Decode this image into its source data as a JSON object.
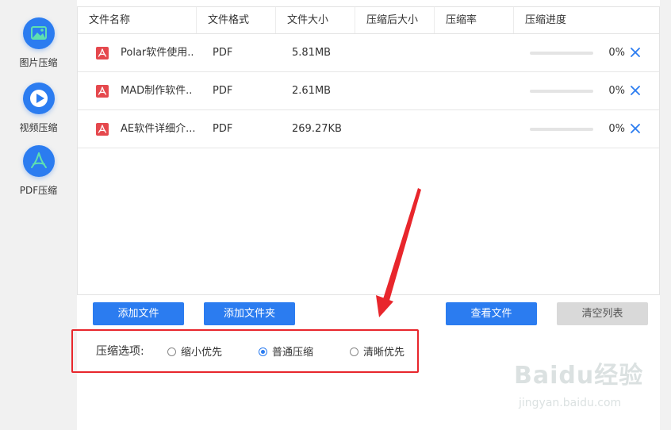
{
  "sidebar": {
    "items": [
      {
        "label": "图片压缩",
        "icon": "image-icon"
      },
      {
        "label": "视频压缩",
        "icon": "play-icon"
      },
      {
        "label": "PDF压缩",
        "icon": "pdf-icon"
      }
    ]
  },
  "table": {
    "headers": [
      "文件名称",
      "文件格式",
      "文件大小",
      "压缩后大小",
      "压缩率",
      "压缩进度"
    ],
    "rows": [
      {
        "name": "Polar软件使用..",
        "format": "PDF",
        "size": "5.81MB",
        "compressed": "",
        "ratio": "",
        "progress_value": 0,
        "progress_text": "0%"
      },
      {
        "name": "MAD制作软件..",
        "format": "PDF",
        "size": "2.61MB",
        "compressed": "",
        "ratio": "",
        "progress_value": 0,
        "progress_text": "0%"
      },
      {
        "name": "AE软件详细介...",
        "format": "PDF",
        "size": "269.27KB",
        "compressed": "",
        "ratio": "",
        "progress_value": 0,
        "progress_text": "0%"
      }
    ]
  },
  "buttons": {
    "add_file": "添加文件",
    "add_folder": "添加文件夹",
    "view_files": "查看文件",
    "clear_list": "清空列表"
  },
  "options": {
    "label": "压缩选项:",
    "choices": [
      "缩小优先",
      "普通压缩",
      "清晰优先"
    ],
    "selected": "普通压缩"
  },
  "colors": {
    "accent": "#2b7cf0",
    "annotation": "#e8262c",
    "pdf": "#e5484d"
  },
  "watermark": {
    "logo": "Baidu经验",
    "url": "jingyan.baidu.com"
  }
}
